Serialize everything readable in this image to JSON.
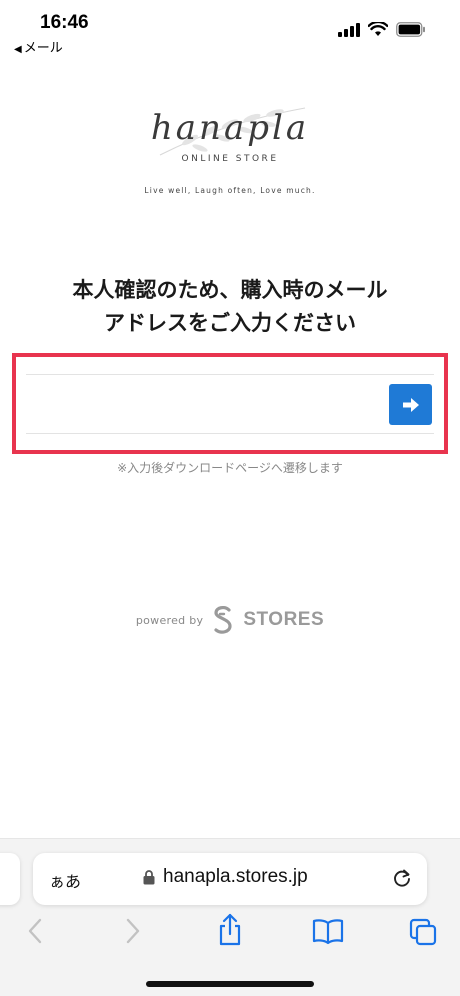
{
  "status_bar": {
    "time": "16:46",
    "back_app": "メール",
    "icons": [
      "signal-icon",
      "wifi-icon",
      "battery-icon"
    ]
  },
  "brand": {
    "name": "hanapla",
    "sub": "ONLINE STORE",
    "tagline": "Live well, Laugh often, Love much."
  },
  "main": {
    "heading_line1": "本人確認のため、購入時のメール",
    "heading_line2": "アドレスをご入力ください",
    "email_value": "",
    "email_placeholder": "",
    "submit_icon": "arrow-right-icon",
    "note": "※入力後ダウンロードページへ遷移します"
  },
  "powered": {
    "label": "powered by",
    "brand": "STORES"
  },
  "browser": {
    "aa_label": "ぁあ",
    "url": "hanapla.stores.jp",
    "toolbar_icons": [
      "back-icon",
      "forward-icon",
      "share-icon",
      "bookmarks-icon",
      "tabs-icon"
    ]
  },
  "colors": {
    "highlight": "#e8344e",
    "button": "#1f7ad6",
    "link_blue": "#1a73e8"
  }
}
